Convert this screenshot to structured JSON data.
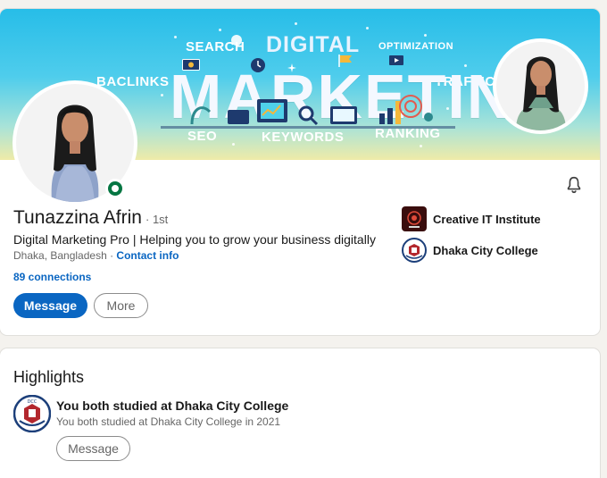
{
  "banner": {
    "words": {
      "digital": "DIGITAL",
      "marketing": "MARKETING",
      "search": "SEARCH",
      "optimization": "OPTIMIZATION",
      "backlinks": "BACLINKS",
      "traffic": "TRAFFIC",
      "seo": "SEO",
      "keywords": "KEYWORDS",
      "ranking": "RANKING"
    }
  },
  "profile": {
    "name": "Tunazzina Afrin",
    "degree": "· 1st",
    "headline": "Digital Marketing Pro | Helping you to grow your business digitally",
    "location": "Dhaka, Bangladesh",
    "location_separator": " · ",
    "contact_info": "Contact info",
    "connections": "89 connections",
    "status_color": "#057642"
  },
  "actions": {
    "message": "Message",
    "more": "More"
  },
  "organizations": [
    {
      "name": "Creative IT Institute",
      "icon": "creative-it-logo"
    },
    {
      "name": "Dhaka City College",
      "icon": "dhaka-city-college-logo"
    }
  ],
  "highlights": {
    "title": "Highlights",
    "item_title": "You both studied at Dhaka City College",
    "item_subtitle": "You both studied at Dhaka City College in 2021",
    "button": "Message"
  },
  "colors": {
    "accent": "#0a66c2",
    "online": "#057642",
    "banner_top": "#27bde8",
    "banner_bottom": "#efeba8"
  }
}
